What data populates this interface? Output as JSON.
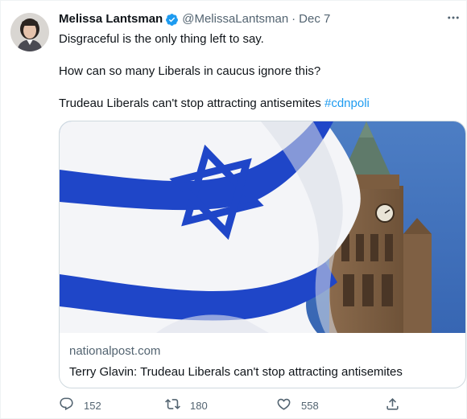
{
  "author": {
    "name": "Melissa Lantsman",
    "handle": "@MelissaLantsman",
    "separator": "·",
    "date": "Dec 7"
  },
  "tweet": {
    "line1": "Disgraceful is the only thing left to say.",
    "line2": "How can so many Liberals in caucus ignore this?",
    "line3_text": "Trudeau Liberals can't stop attracting antisemites ",
    "hashtag": "#cdnpoli"
  },
  "card": {
    "domain": "nationalpost.com",
    "title": "Terry Glavin: Trudeau Liberals can't stop attracting antisemites"
  },
  "actions": {
    "replies": "152",
    "retweets": "180",
    "likes": "558"
  },
  "colors": {
    "accent": "#1d9bf0",
    "secondary_text": "#536471",
    "primary_text": "#0f1419",
    "flag_blue": "#1f46c8",
    "sky": "#3f73bf"
  },
  "icons": [
    "more-icon",
    "verified-icon",
    "reply-icon",
    "retweet-icon",
    "like-icon",
    "share-icon"
  ]
}
